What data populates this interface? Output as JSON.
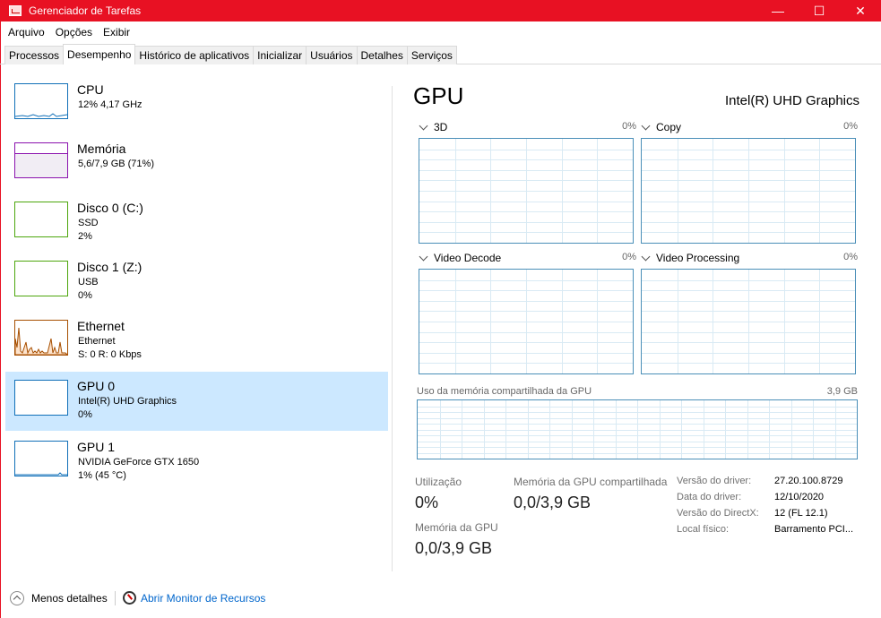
{
  "window": {
    "title": "Gerenciador de Tarefas",
    "controls": {
      "minimize": "—",
      "maximize": "☐",
      "close": "✕"
    }
  },
  "menu": [
    "Arquivo",
    "Opções",
    "Exibir"
  ],
  "tabs": [
    "Processos",
    "Desempenho",
    "Histórico de aplicativos",
    "Inicializar",
    "Usuários",
    "Detalhes",
    "Serviços"
  ],
  "active_tab": "Desempenho",
  "sidebar": {
    "items": [
      {
        "name": "CPU",
        "sub1": "12% 4,17 GHz",
        "sub2": "",
        "color": "#1170b8"
      },
      {
        "name": "Memória",
        "sub1": "5,6/7,9 GB (71%)",
        "sub2": "",
        "color": "#8b12ae"
      },
      {
        "name": "Disco 0 (C:)",
        "sub1": "SSD",
        "sub2": "2%",
        "color": "#4da60c"
      },
      {
        "name": "Disco 1 (Z:)",
        "sub1": "USB",
        "sub2": "0%",
        "color": "#4da60c"
      },
      {
        "name": "Ethernet",
        "sub1": "Ethernet",
        "sub2": "S: 0 R: 0 Kbps",
        "color": "#a74f01"
      },
      {
        "name": "GPU 0",
        "sub1": "Intel(R) UHD Graphics",
        "sub2": "0%",
        "color": "#1170b8"
      },
      {
        "name": "GPU 1",
        "sub1": "NVIDIA GeForce GTX 1650",
        "sub2": "1% (45 °C)",
        "color": "#1170b8"
      }
    ]
  },
  "gpu": {
    "title": "GPU",
    "model": "Intel(R) UHD Graphics",
    "engines": [
      {
        "name": "3D",
        "pct": "0%"
      },
      {
        "name": "Copy",
        "pct": "0%"
      },
      {
        "name": "Video Decode",
        "pct": "0%"
      },
      {
        "name": "Video Processing",
        "pct": "0%"
      }
    ],
    "shared_memory_label": "Uso da memória compartilhada da GPU",
    "shared_memory_total": "3,9 GB",
    "stats": {
      "utilization_label": "Utilização",
      "utilization_value": "0%",
      "shared_mem_label": "Memória da GPU compartilhada",
      "shared_mem_value": "0,0/3,9 GB",
      "gpu_mem_label": "Memória da GPU",
      "gpu_mem_value": "0,0/3,9 GB"
    },
    "info": [
      {
        "label": "Versão do driver:",
        "value": "27.20.100.8729"
      },
      {
        "label": "Data do driver:",
        "value": "12/10/2020"
      },
      {
        "label": "Versão do DirectX:",
        "value": "12 (FL 12.1)"
      },
      {
        "label": "Local físico:",
        "value": "Barramento PCI..."
      }
    ]
  },
  "footer": {
    "less_details": "Menos detalhes",
    "open_monitor": "Abrir Monitor de Recursos"
  },
  "colors": {
    "titlebar": "#e81123",
    "selection": "#cce8ff",
    "graph_border": "#4a8fb8",
    "link": "#0066cc"
  }
}
